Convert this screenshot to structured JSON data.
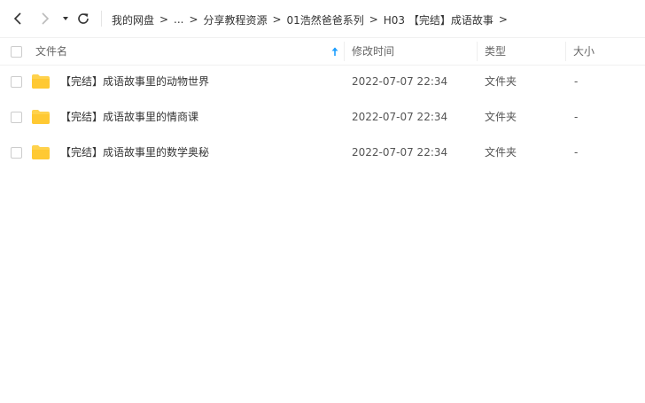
{
  "navigation": {
    "back_icon": "chevron-left-icon",
    "forward_icon": "chevron-right-icon",
    "history_icon": "caret-down-icon",
    "refresh_icon": "refresh-icon"
  },
  "breadcrumb": {
    "items": [
      "我的网盘",
      "...",
      "分享教程资源",
      "01浩然爸爸系列",
      "H03 【完结】成语故事"
    ],
    "separator": ">"
  },
  "table": {
    "headers": {
      "name": "文件名",
      "modified": "修改时间",
      "type": "类型",
      "size": "大小"
    },
    "sort_icon": "sort-up-arrow-icon",
    "rows": [
      {
        "name": "【完结】成语故事里的动物世界",
        "modified": "2022-07-07 22:34",
        "type": "文件夹",
        "size": "-",
        "icon": "folder-icon"
      },
      {
        "name": "【完结】成语故事里的情商课",
        "modified": "2022-07-07 22:34",
        "type": "文件夹",
        "size": "-",
        "icon": "folder-icon"
      },
      {
        "name": "【完结】成语故事里的数学奥秘",
        "modified": "2022-07-07 22:34",
        "type": "文件夹",
        "size": "-",
        "icon": "folder-icon"
      }
    ]
  },
  "colors": {
    "folder": "#ffd24d",
    "accent": "#1e9fff",
    "border": "#f0f0f0"
  }
}
